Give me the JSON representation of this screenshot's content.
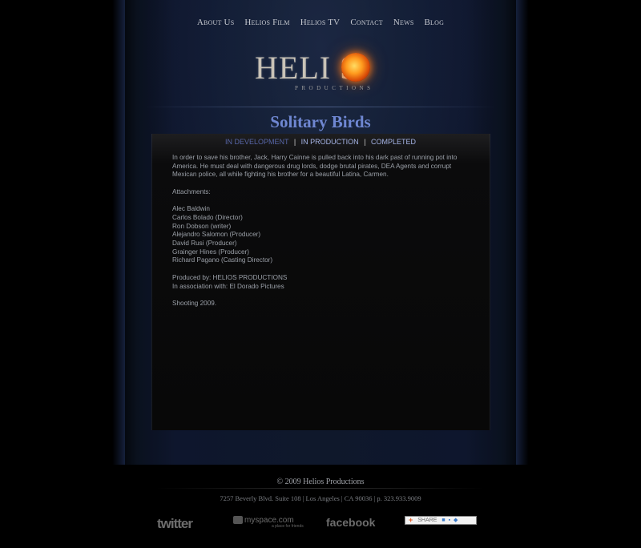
{
  "nav": {
    "items": [
      "About Us",
      "Helios Film",
      "Helios TV",
      "Contact",
      "News",
      "Blog"
    ]
  },
  "logo": {
    "title": "HELI  S",
    "subtitle": "PRODUCTIONS"
  },
  "page": {
    "title": "Solitary Birds"
  },
  "tabs": {
    "in_development": "IN DEVELOPMENT",
    "in_production": "IN PRODUCTION",
    "completed": "COMPLETED",
    "separator": "|"
  },
  "content": {
    "synopsis": "In order to save his brother, Jack, Harry Cainne is pulled back into his dark past of running pot into America. He must deal with dangerous drug lords, dodge brutal pirates, DEA Agents and corrupt Mexican police, all while fighting his brother for a beautiful Latina, Carmen.",
    "attachments_label": "Attachments:",
    "attachments": [
      "Alec Baldwin",
      "Carlos Bolado (Director)",
      "Ron Dobson (writer)",
      "Alejandro Salomon (Producer)",
      "David Rusi (Producer)",
      "Grainger Hines (Producer)",
      "Richard Pagano (Casting Director)"
    ],
    "produced_by": "Produced by: HELIOS PRODUCTIONS",
    "association": "In association with: El Dorado Pictures",
    "shooting": "Shooting 2009."
  },
  "footer": {
    "copyright": "© 2009 Helios Productions",
    "address": "7257 Beverly Blvd. Suite 108 | Los Angeles | CA 90036 | p. 323.933.9009"
  },
  "social": {
    "twitter": "twitter",
    "myspace": "myspace.com",
    "myspace_sub": "a place for friends",
    "facebook": "facebook",
    "share": "SHARE"
  }
}
